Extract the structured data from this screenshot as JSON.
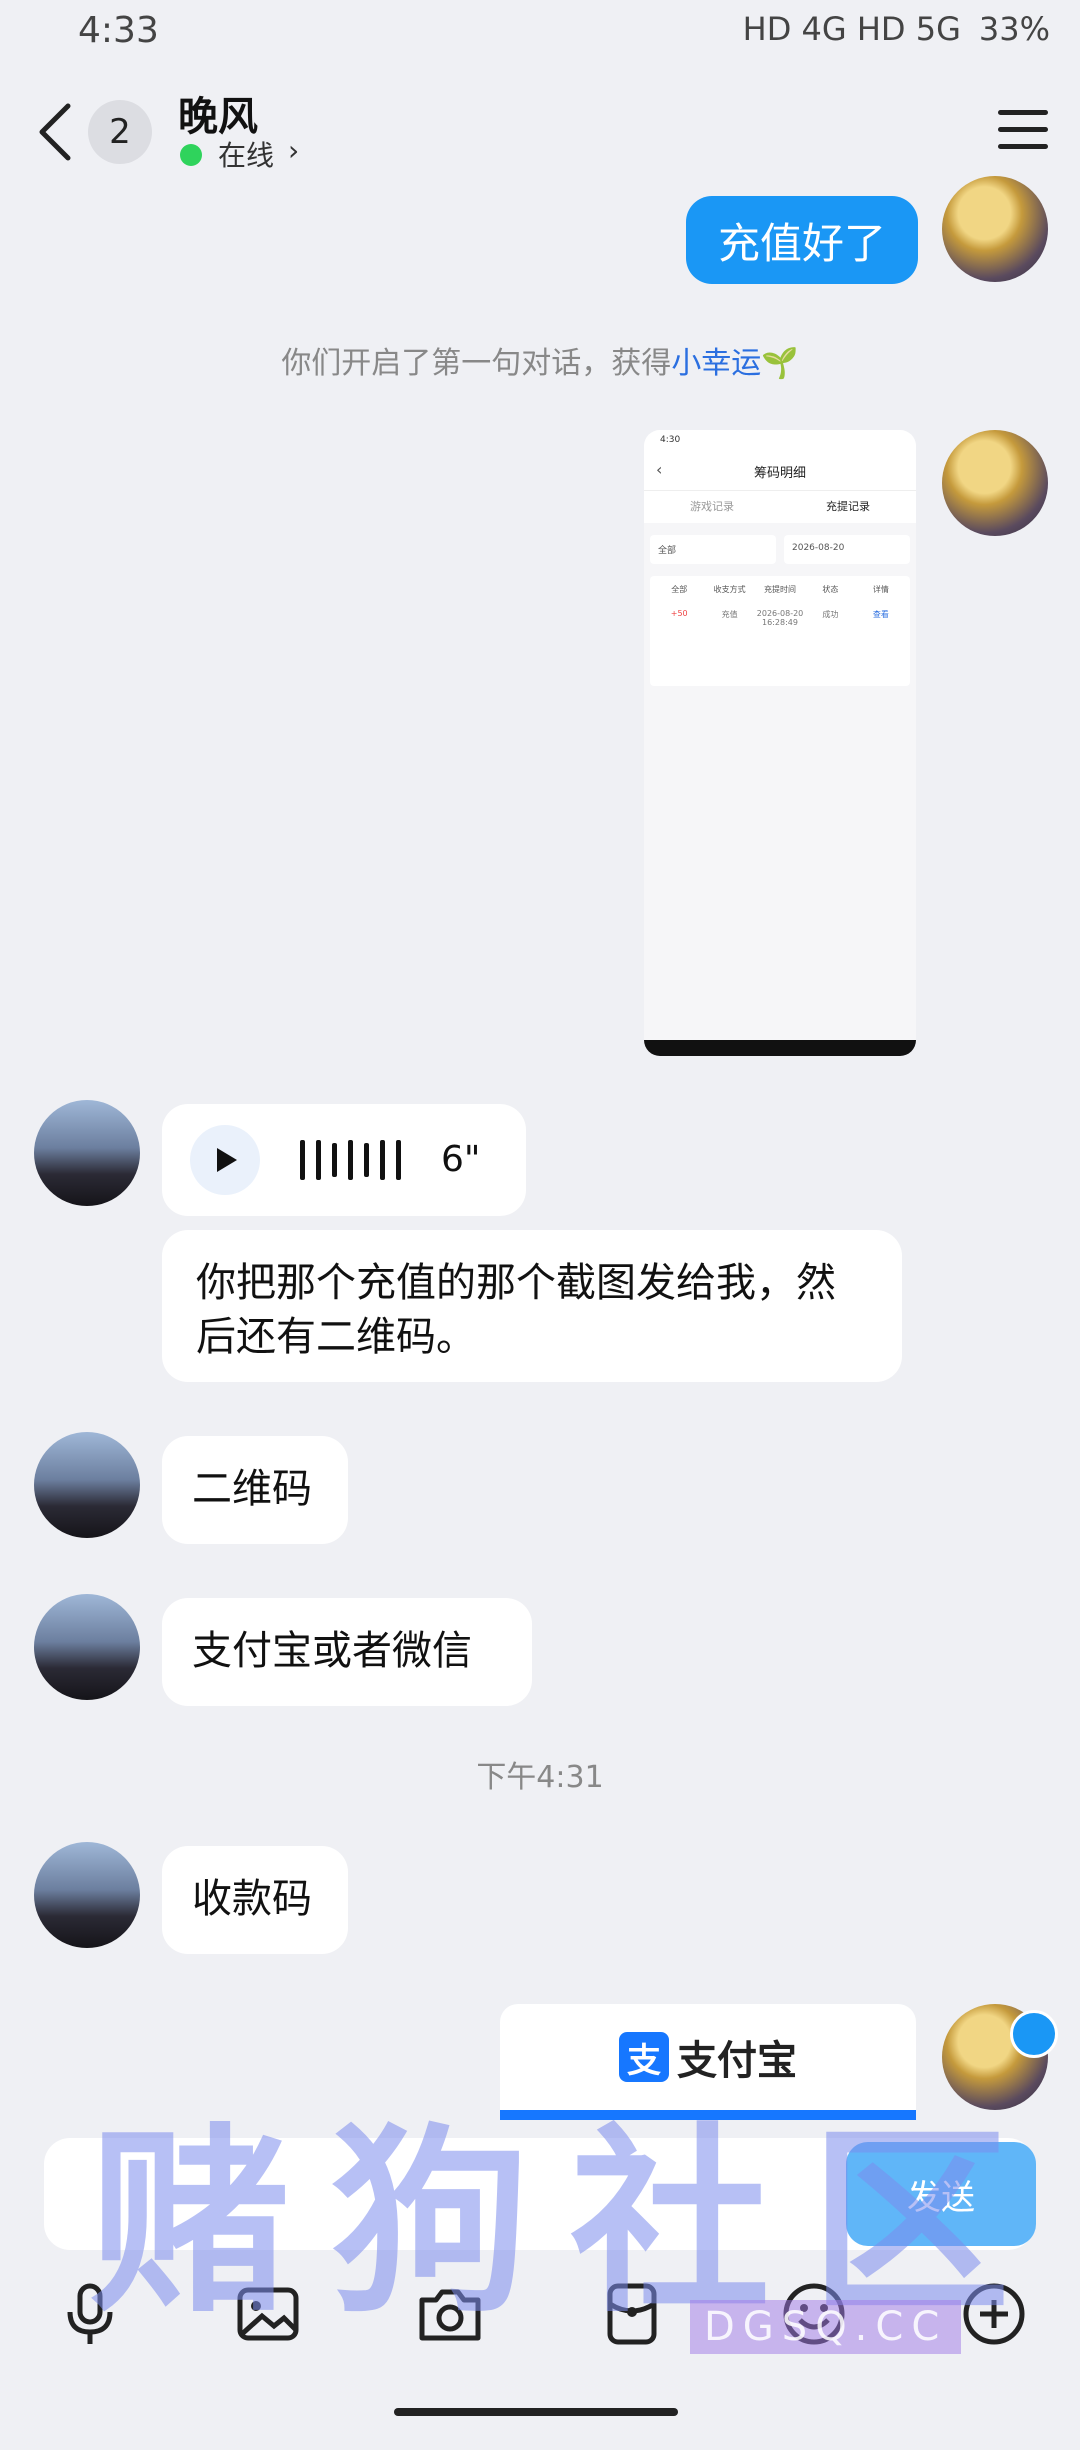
{
  "status": {
    "time": "4:33",
    "network": "HD 4G HD 5G",
    "battery": "33%"
  },
  "header": {
    "unread_count": "2",
    "contact_name": "晚风",
    "online_status": "在线",
    "chevron": "›"
  },
  "messages": {
    "sent_text_1": "充值好了",
    "system_notice_prefix": "你们开启了第一句对话，获得",
    "system_notice_highlight": "小幸运",
    "voice_duration": "6\"",
    "received_text_1": "你把那个充值的那个截图发给我，然后还有二维码。",
    "received_text_2": "二维码",
    "received_text_3": "支付宝或者微信",
    "timestamp": "下午4:31",
    "received_text_4": "收款码",
    "alipay_label": "支付宝"
  },
  "screenshot": {
    "title": "筹码明细",
    "tab_1": "游戏记录",
    "tab_2": "充提记录",
    "filter_1": "全部",
    "filter_2": "2026-08-20",
    "col_headers": [
      "全部",
      "收支方式",
      "充提时间",
      "状态",
      "详情"
    ],
    "row": [
      "+50",
      "充值",
      "2026-08-20 16:28:49",
      "成功",
      "查看"
    ]
  },
  "input": {
    "send_label": "发送"
  },
  "watermark": {
    "main": "赌狗社区",
    "url": "DGSQ.CC"
  },
  "icons": [
    "mic-icon",
    "image-icon",
    "camera-icon",
    "red-packet-icon",
    "emoji-icon",
    "plus-icon"
  ]
}
